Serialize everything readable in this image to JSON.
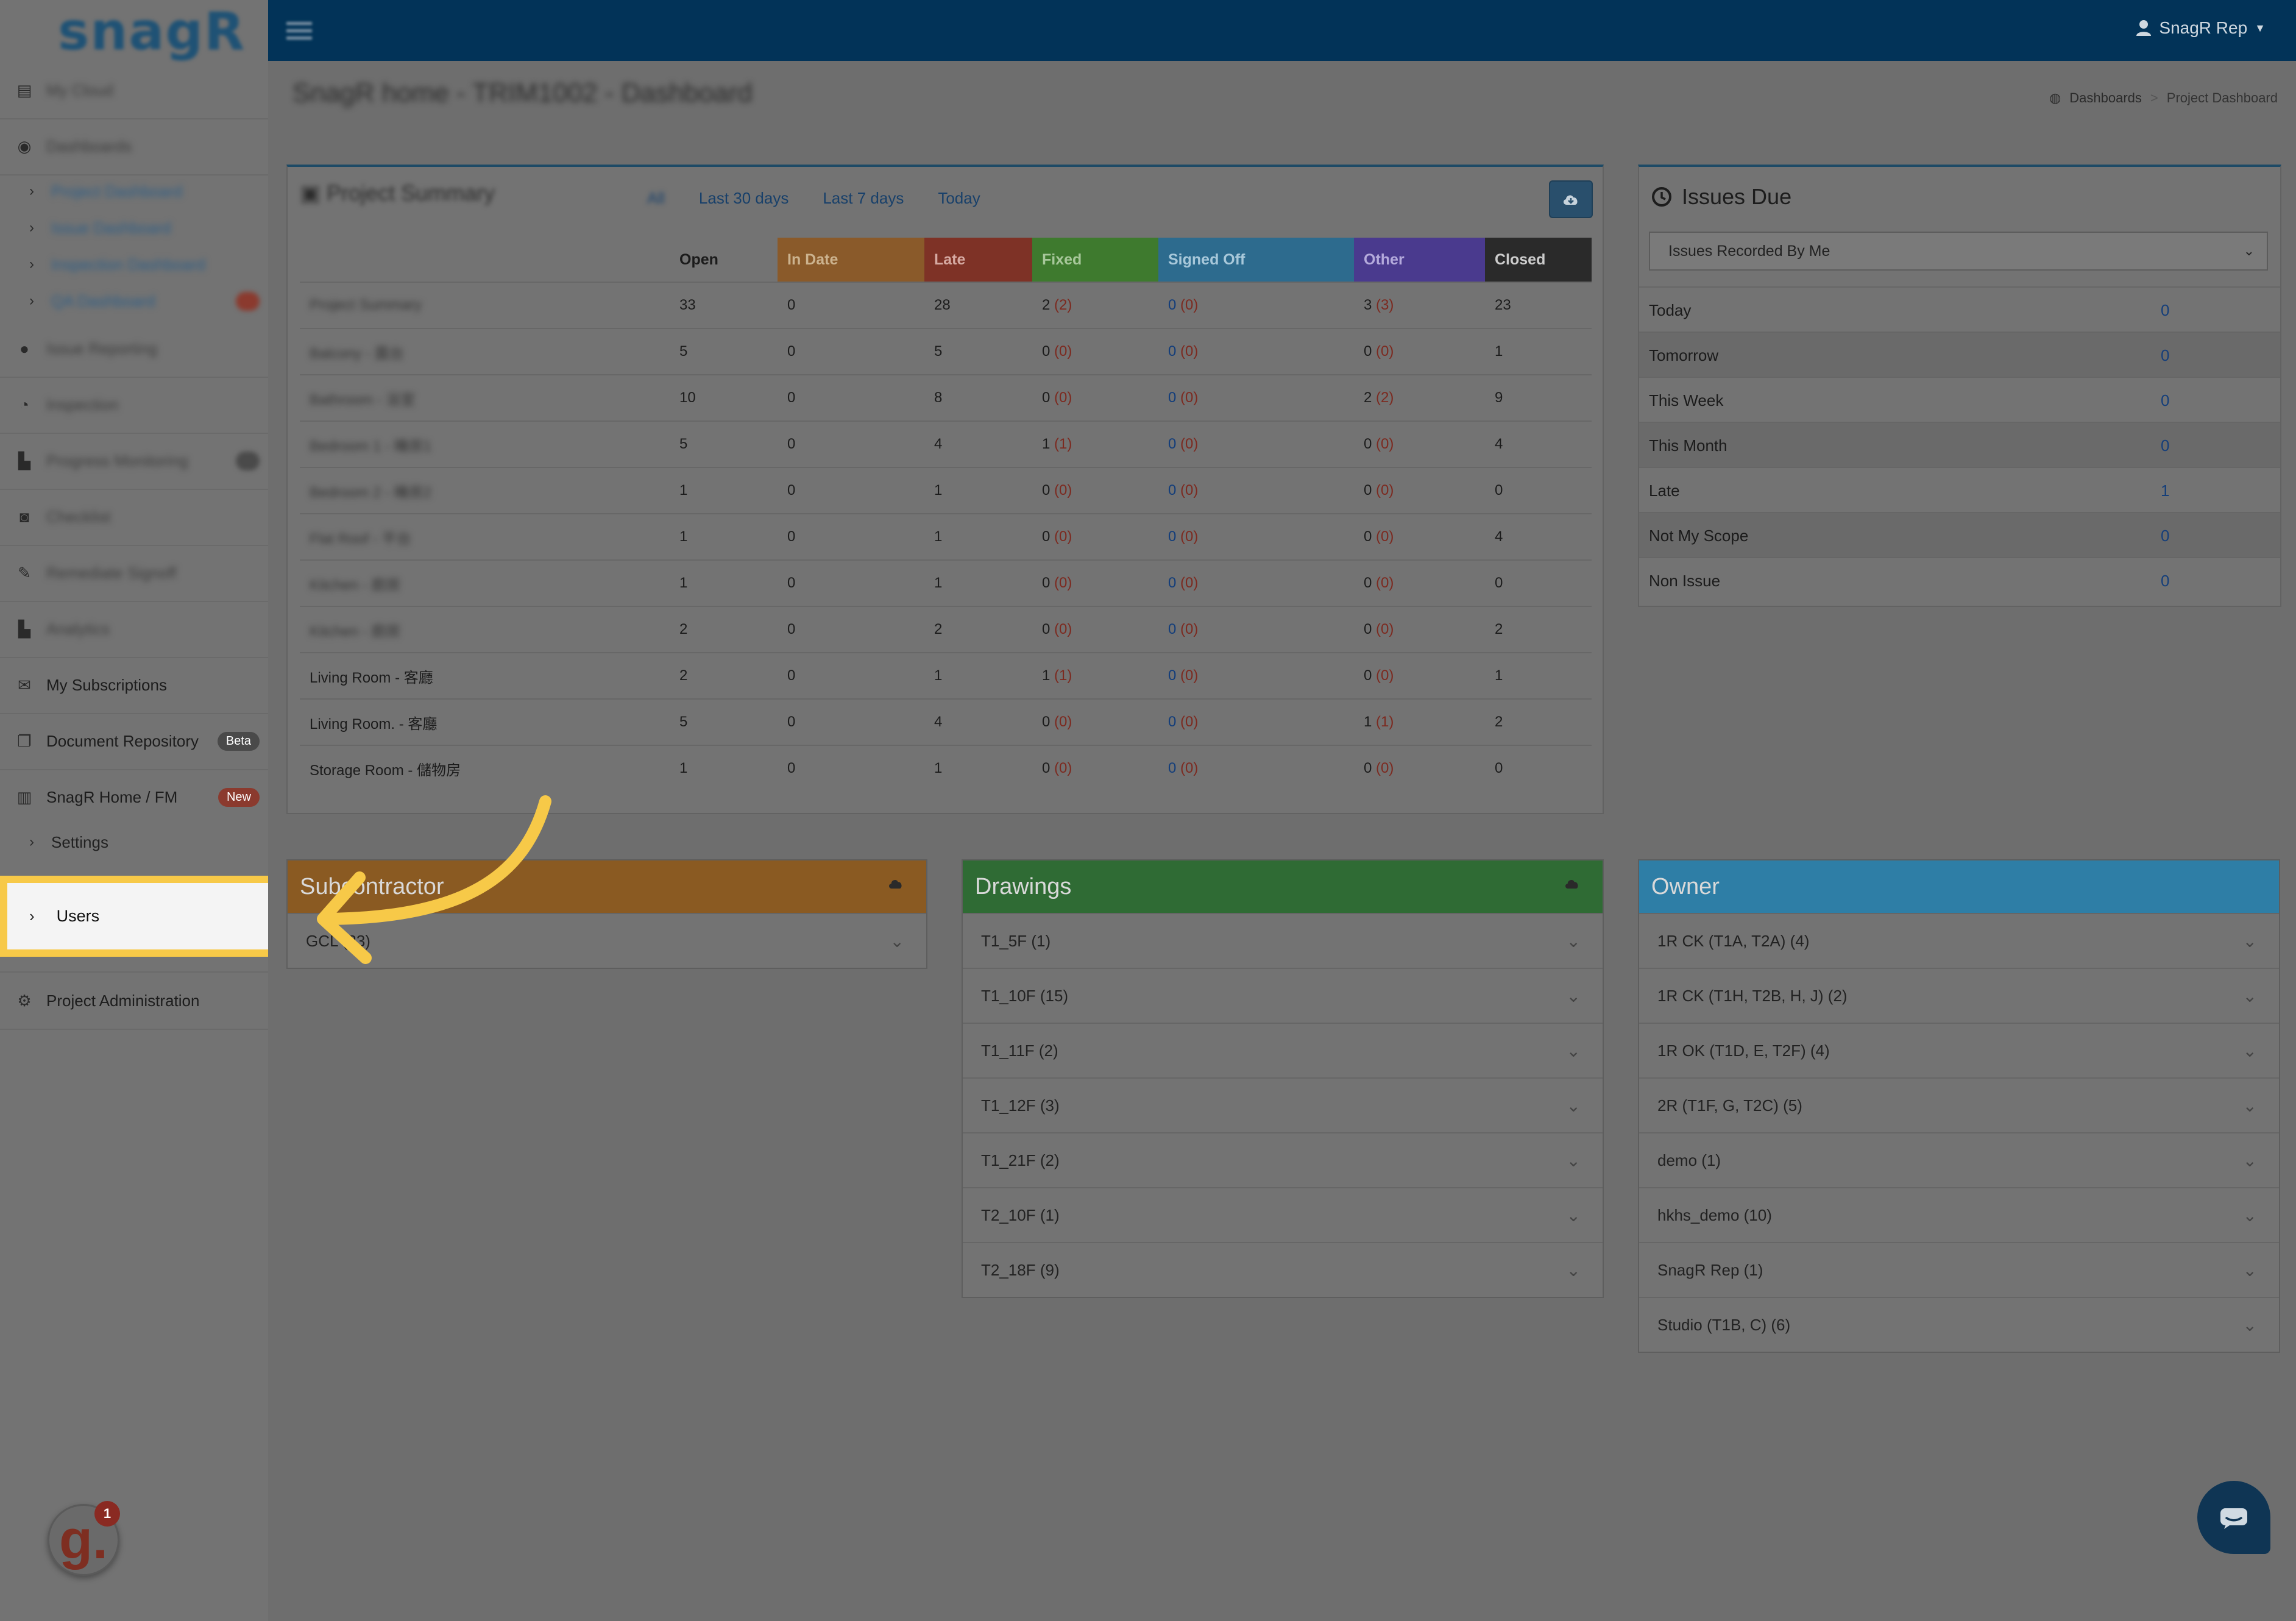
{
  "app": {
    "logo": "snagR",
    "user_name": "SnagR Rep"
  },
  "sidebar": {
    "items": [
      {
        "label": "My Cloud",
        "blurred": true
      },
      {
        "label": "Dashboards",
        "blurred": true
      },
      {
        "label": "Issue Reporting",
        "blurred": true
      },
      {
        "label": "Inspection",
        "blurred": true
      },
      {
        "label": "Progress Monitoring",
        "blurred": true
      },
      {
        "label": "Checklist",
        "blurred": true
      },
      {
        "label": "Remediate Signoff",
        "blurred": true
      },
      {
        "label": "Analytics",
        "blurred": true
      },
      {
        "label": "My Subscriptions",
        "blurred": false
      },
      {
        "label": "Document Repository",
        "badge": "Beta",
        "blurred": false
      },
      {
        "label": "SnagR Home / FM",
        "badge": "New",
        "blurred": false
      },
      {
        "label": "Project Administration",
        "blurred": false
      }
    ],
    "dashboard_subs": [
      "Project Dashboard",
      "Issue Dashboard",
      "Inspection Dashboard",
      "QA Dashboard"
    ],
    "home_subs": {
      "settings": "Settings",
      "users": "Users"
    }
  },
  "page": {
    "title_visible": "SnagR home - TRIM1002 - Dashboard",
    "breadcrumb_root": "Dashboards",
    "breadcrumb_current": "Project Dashboard"
  },
  "summary": {
    "title": "Project Summary",
    "ranges": [
      "All",
      "Last 30 days",
      "Last 7 days",
      "Today"
    ],
    "columns": [
      "Open",
      "In Date",
      "Late",
      "Fixed",
      "Signed Off",
      "Other",
      "Closed"
    ],
    "column_colors": {
      "in_date": "#8a5a2a",
      "late": "#7e3226",
      "fixed": "#3e7a2e",
      "signed_off": "#2d6b8e",
      "other": "#4a3a8e",
      "closed": "#2a2a2a"
    },
    "rows": [
      {
        "name": "Project Summary",
        "blur": true,
        "open": "33",
        "in_date": "0",
        "late": "28",
        "fixed": "2",
        "fixed_sub": "(2)",
        "signed": "0",
        "signed_sub": "(0)",
        "other": "3",
        "other_sub": "(3)",
        "closed": "23"
      },
      {
        "name": "Balcony - 露台",
        "blur": true,
        "open": "5",
        "in_date": "0",
        "late": "5",
        "fixed": "0",
        "fixed_sub": "(0)",
        "signed": "0",
        "signed_sub": "(0)",
        "other": "0",
        "other_sub": "(0)",
        "closed": "1"
      },
      {
        "name": "Bathroom - 浴室",
        "blur": true,
        "open": "10",
        "in_date": "0",
        "late": "8",
        "fixed": "0",
        "fixed_sub": "(0)",
        "signed": "0",
        "signed_sub": "(0)",
        "other": "2",
        "other_sub": "(2)",
        "closed": "9"
      },
      {
        "name": "Bedroom 1 - 睡房1",
        "blur": true,
        "open": "5",
        "in_date": "0",
        "late": "4",
        "fixed": "1",
        "fixed_sub": "(1)",
        "signed": "0",
        "signed_sub": "(0)",
        "other": "0",
        "other_sub": "(0)",
        "closed": "4"
      },
      {
        "name": "Bedroom 2 - 睡房2",
        "blur": true,
        "open": "1",
        "in_date": "0",
        "late": "1",
        "fixed": "0",
        "fixed_sub": "(0)",
        "signed": "0",
        "signed_sub": "(0)",
        "other": "0",
        "other_sub": "(0)",
        "closed": "0"
      },
      {
        "name": "Flat Roof - 平台",
        "blur": true,
        "open": "1",
        "in_date": "0",
        "late": "1",
        "fixed": "0",
        "fixed_sub": "(0)",
        "signed": "0",
        "signed_sub": "(0)",
        "other": "0",
        "other_sub": "(0)",
        "closed": "4"
      },
      {
        "name": "Kitchen - 廚房",
        "blur": true,
        "open": "1",
        "in_date": "0",
        "late": "1",
        "fixed": "0",
        "fixed_sub": "(0)",
        "signed": "0",
        "signed_sub": "(0)",
        "other": "0",
        "other_sub": "(0)",
        "closed": "0"
      },
      {
        "name": "Kitchen - 廚房",
        "blur": true,
        "open": "2",
        "in_date": "0",
        "late": "2",
        "fixed": "0",
        "fixed_sub": "(0)",
        "signed": "0",
        "signed_sub": "(0)",
        "other": "0",
        "other_sub": "(0)",
        "closed": "2"
      },
      {
        "name": "Living Room - 客廳",
        "blur": false,
        "open": "2",
        "in_date": "0",
        "late": "1",
        "fixed": "1",
        "fixed_sub": "(1)",
        "signed": "0",
        "signed_sub": "(0)",
        "other": "0",
        "other_sub": "(0)",
        "closed": "1"
      },
      {
        "name": "Living Room. - 客廳",
        "blur": false,
        "open": "5",
        "in_date": "0",
        "late": "4",
        "fixed": "0",
        "fixed_sub": "(0)",
        "signed": "0",
        "signed_sub": "(0)",
        "other": "1",
        "other_sub": "(1)",
        "closed": "2"
      },
      {
        "name": "Storage Room - 儲物房",
        "blur": false,
        "open": "1",
        "in_date": "0",
        "late": "1",
        "fixed": "0",
        "fixed_sub": "(0)",
        "signed": "0",
        "signed_sub": "(0)",
        "other": "0",
        "other_sub": "(0)",
        "closed": "0"
      }
    ]
  },
  "issues_due": {
    "title": "Issues Due",
    "filter": "Issues Recorded By Me",
    "rows": [
      {
        "label": "Today",
        "value": "0"
      },
      {
        "label": "Tomorrow",
        "value": "0"
      },
      {
        "label": "This Week",
        "value": "0"
      },
      {
        "label": "This Month",
        "value": "0"
      },
      {
        "label": "Late",
        "value": "1"
      },
      {
        "label": "Not My Scope",
        "value": "0"
      },
      {
        "label": "Non Issue",
        "value": "0"
      }
    ]
  },
  "subcontractor": {
    "title": "Subcontractor",
    "color": "#8a5a22",
    "rows": [
      "GCL (33)"
    ]
  },
  "drawings": {
    "title": "Drawings",
    "color": "#2f6b34",
    "rows": [
      "T1_5F (1)",
      "T1_10F (15)",
      "T1_11F (2)",
      "T1_12F (3)",
      "T1_21F (2)",
      "T2_10F (1)",
      "T2_18F (9)"
    ]
  },
  "owner": {
    "title": "Owner",
    "color": "#2e7ea6",
    "rows": [
      "1R CK (T1A, T2A) (4)",
      "1R CK (T1H, T2B, H, J) (2)",
      "1R OK (T1D, E, T2F) (4)",
      "2R (T1F, G, T2C) (5)",
      "demo (1)",
      "hkhs_demo (10)",
      "SnagR Rep (1)",
      "Studio (T1B, C) (6)"
    ]
  },
  "badge": {
    "letter": "g.",
    "count": "1"
  },
  "highlight_color": "#f7c948"
}
